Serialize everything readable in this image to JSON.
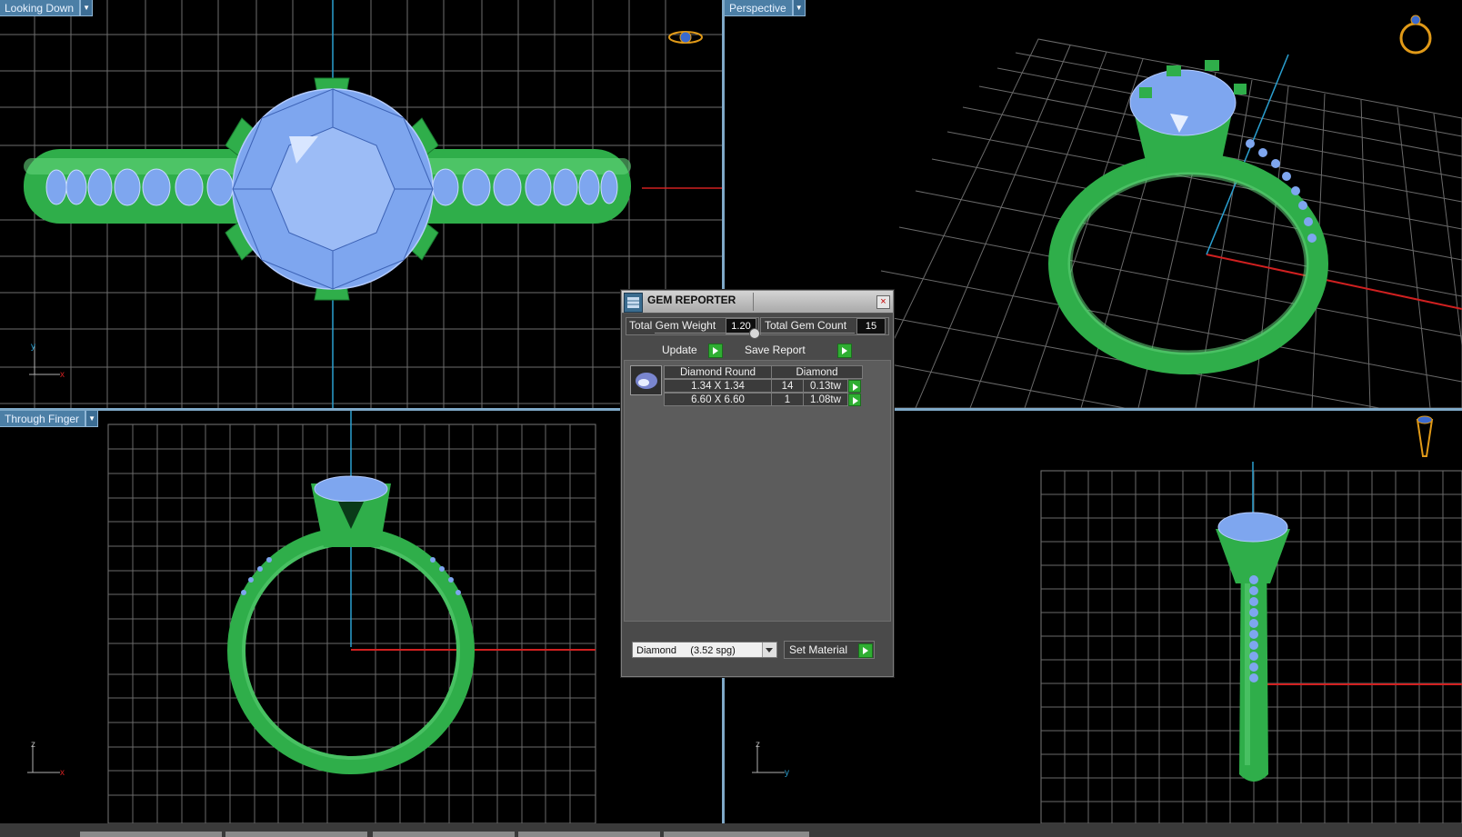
{
  "viewports": {
    "top_left": {
      "label": "Looking Down"
    },
    "top_right": {
      "label": "Perspective"
    },
    "bottom_left": {
      "label": "Through Finger"
    },
    "bottom_right": {
      "label": ""
    }
  },
  "axes": {
    "top_left": {
      "v": "y",
      "h": "x"
    },
    "bottom_left": {
      "v": "z",
      "h": "x"
    },
    "bottom_right": {
      "v": "z",
      "h": "y"
    }
  },
  "gem_reporter": {
    "title": "GEM REPORTER",
    "close": "×",
    "total_weight_label": "Total Gem Weight",
    "total_weight_value": "1.20",
    "total_count_label": "Total Gem Count",
    "total_count_value": "15",
    "update_label": "Update",
    "save_report_label": "Save Report",
    "table": {
      "header": [
        "Diamond Round",
        "Diamond"
      ],
      "rows": [
        {
          "size": "1.34 X 1.34",
          "count": "14",
          "weight": "0.13tw"
        },
        {
          "size": "6.60 X 6.60",
          "count": "1",
          "weight": "1.08tw"
        }
      ]
    },
    "material_select": "Diamond     (3.52 spg)",
    "set_material_label": "Set Material"
  },
  "colors": {
    "metal": "#2fae4a",
    "gem": "#7ea6ef",
    "grid": "#7a7a7a",
    "axis_blue": "#2a9fd0",
    "axis_red": "#d02020",
    "accent": "#4c7fa6"
  }
}
